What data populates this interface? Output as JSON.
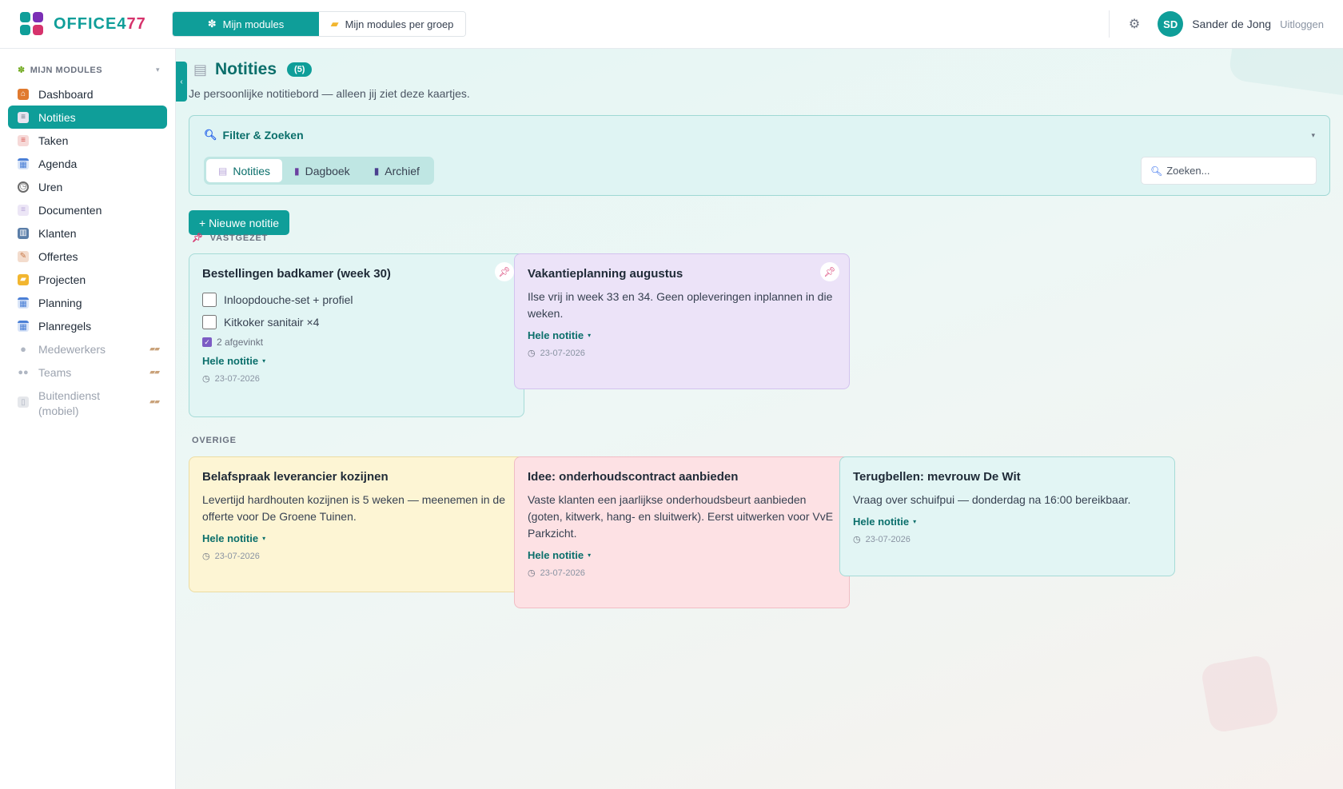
{
  "app": {
    "logo_main": "OFFICE4",
    "logo_accent": "77",
    "logo_colors": [
      "#0f9e99",
      "#7b2fb5",
      "#0f9e99",
      "#d6336c"
    ]
  },
  "topnav": {
    "items": [
      {
        "label": "Mijn modules",
        "icon": "puzzle-icon",
        "active": true
      },
      {
        "label": "Mijn modules per groep",
        "icon": "folder-icon",
        "active": false
      }
    ]
  },
  "user": {
    "initials": "SD",
    "name": "Sander de Jong",
    "logout_label": "Uitloggen"
  },
  "sidebar": {
    "header": "MIJN MODULES",
    "items": [
      {
        "label": "Dashboard",
        "icon": "house-icon",
        "color": "#e07a2f",
        "active": false,
        "locked": false
      },
      {
        "label": "Notities",
        "icon": "memo-icon",
        "color": "#e8e4f0",
        "active": true,
        "locked": false
      },
      {
        "label": "Taken",
        "icon": "clipboard-icon",
        "color": "#d9534f",
        "active": false,
        "locked": false
      },
      {
        "label": "Agenda",
        "icon": "calendar-icon",
        "color": "#4a7fd6",
        "active": false,
        "locked": false
      },
      {
        "label": "Uren",
        "icon": "clock-icon",
        "color": "#6b6b6b",
        "active": false,
        "locked": false
      },
      {
        "label": "Documenten",
        "icon": "document-icon",
        "color": "#b9a7d9",
        "active": false,
        "locked": false
      },
      {
        "label": "Klanten",
        "icon": "building-icon",
        "color": "#5b7ea8",
        "active": false,
        "locked": false
      },
      {
        "label": "Offertes",
        "icon": "edit-icon",
        "color": "#c97a4a",
        "active": false,
        "locked": false
      },
      {
        "label": "Projecten",
        "icon": "folder-icon",
        "color": "#f2b630",
        "active": false,
        "locked": false
      },
      {
        "label": "Planning",
        "icon": "calendar-grid-icon",
        "color": "#4a7fd6",
        "active": false,
        "locked": false
      },
      {
        "label": "Planregels",
        "icon": "calendar-grid-icon",
        "color": "#4a7fd6",
        "active": false,
        "locked": false
      },
      {
        "label": "Medewerkers",
        "icon": "person-icon",
        "color": "#b0b7c3",
        "active": false,
        "locked": true
      },
      {
        "label": "Teams",
        "icon": "people-icon",
        "color": "#b0b7c3",
        "active": false,
        "locked": true
      },
      {
        "label": "Buitendienst (mobiel)",
        "icon": "phone-icon",
        "color": "#b0b7c3",
        "active": false,
        "locked": true
      }
    ]
  },
  "page": {
    "title": "Notities",
    "count": "(5)",
    "subtitle": "Je persoonlijke notitiebord — alleen jij ziet deze kaartjes."
  },
  "filter": {
    "title": "Filter & Zoeken",
    "tabs": [
      {
        "label": "Notities",
        "icon": "memo-icon",
        "active": true
      },
      {
        "label": "Dagboek",
        "icon": "book-icon",
        "active": false
      },
      {
        "label": "Archief",
        "icon": "archive-book-icon",
        "active": false
      }
    ],
    "search_placeholder": "Zoeken..."
  },
  "new_note_label": "+ Nieuwe notitie",
  "sections": {
    "pinned": "VASTGEZET",
    "other": "OVERIGE"
  },
  "notes": {
    "pinned": [
      {
        "title": "Bestellingen badkamer (week 30)",
        "checklist": [
          "Inloopdouche-set + profiel",
          "Kitkoker sanitair ×4"
        ],
        "checked_count": "2 afgevinkt",
        "more": "Hele notitie",
        "date": "23-07-2026",
        "color": "teal"
      },
      {
        "title": "Vakantieplanning augustus",
        "body": "Ilse vrij in week 33 en 34. Geen opleveringen inplannen in die weken.",
        "more": "Hele notitie",
        "date": "23-07-2026",
        "color": "purple"
      }
    ],
    "other": [
      {
        "title": "Belafspraak leverancier kozijnen",
        "body": "Levertijd hardhouten kozijnen is 5 weken — meenemen in de offerte voor De Groene Tuinen.",
        "more": "Hele notitie",
        "date": "23-07-2026",
        "color": "yellow"
      },
      {
        "title": "Idee: onderhoudscontract aanbieden",
        "body": "Vaste klanten een jaarlijkse onderhoudsbeurt aanbieden (goten, kitwerk, hang- en sluitwerk). Eerst uitwerken voor VvE Parkzicht.",
        "more": "Hele notitie",
        "date": "23-07-2026",
        "color": "pink"
      },
      {
        "title": "Terugbellen: mevrouw De Wit",
        "body": "Vraag over schuifpui — donderdag na 16:00 bereikbaar.",
        "more": "Hele notitie",
        "date": "23-07-2026",
        "color": "teal"
      }
    ]
  }
}
